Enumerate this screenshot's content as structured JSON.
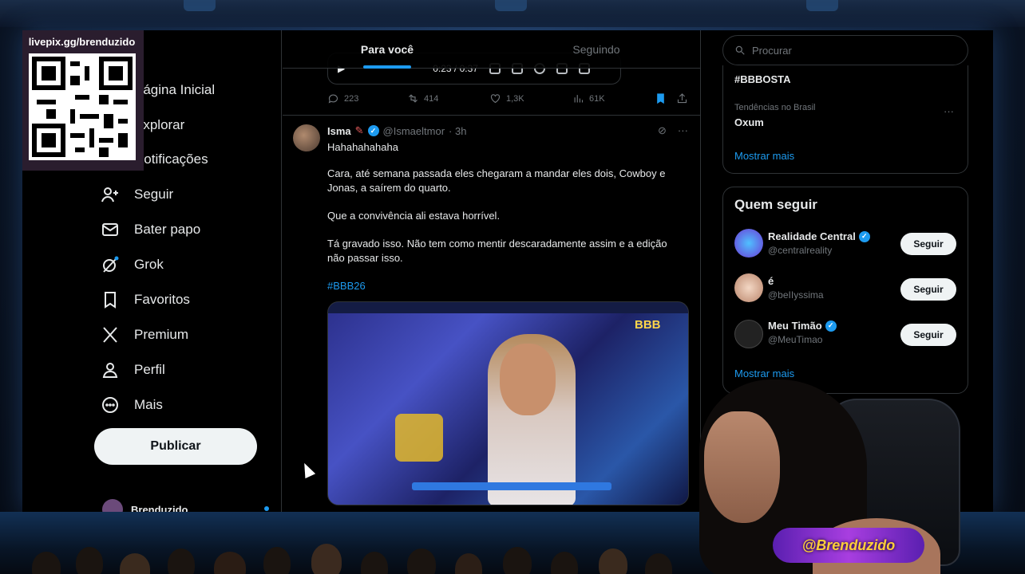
{
  "overlay": {
    "qr_label": "livepix.gg/brenduzido",
    "streamer_badge": "@Brenduzido"
  },
  "nav": {
    "items": [
      {
        "label": "Página Inicial",
        "icon": "home-icon"
      },
      {
        "label": "Explorar",
        "icon": "search-icon"
      },
      {
        "label": "Notificações",
        "icon": "bell-icon"
      },
      {
        "label": "Seguir",
        "icon": "add-user-icon"
      },
      {
        "label": "Bater papo",
        "icon": "mail-icon"
      },
      {
        "label": "Grok",
        "icon": "grok-icon"
      },
      {
        "label": "Favoritos",
        "icon": "bookmark-icon"
      },
      {
        "label": "Premium",
        "icon": "x-logo-icon"
      },
      {
        "label": "Perfil",
        "icon": "profile-icon"
      },
      {
        "label": "Mais",
        "icon": "more-circle-icon"
      }
    ],
    "publish_label": "Publicar",
    "account_name": "Brenduzido"
  },
  "feed": {
    "tabs": [
      {
        "label": "Para você",
        "active": true
      },
      {
        "label": "Seguindo",
        "active": false
      }
    ],
    "prev_tweet": {
      "audio_time": "0:23 / 0:37",
      "replies": "223",
      "reposts": "414",
      "likes": "1,3K",
      "views": "61K"
    },
    "tweet": {
      "name": "Isma",
      "handle": "@Ismaeltmor",
      "time": "· 3h",
      "lines": [
        "Hahahahahaha",
        "Cara, até semana passada eles chegaram a mandar eles dois, Cowboy e Jonas, a saírem do quarto.",
        "Que a convivência ali estava horrível.",
        "Tá gravado isso. Não tem como mentir descaradamente assim e a edição não passar isso."
      ],
      "hashtag": "#BBB26",
      "media_logo": "BBB"
    }
  },
  "right": {
    "search_placeholder": "Procurar",
    "trends": [
      {
        "context": "",
        "name": "#BBBOSTA"
      },
      {
        "context": "Tendências no Brasil",
        "name": "Oxum"
      }
    ],
    "trends_more": "Mostrar mais",
    "who_title": "Quem seguir",
    "who": [
      {
        "name": "Realidade Central",
        "handle": "@centralreality",
        "verified": true,
        "button": "Seguir"
      },
      {
        "name": "é",
        "handle": "@beIIyssima",
        "verified": false,
        "button": "Seguir"
      },
      {
        "name": "Meu Timão",
        "handle": "@MeuTimao",
        "verified": true,
        "button": "Seguir"
      }
    ],
    "who_more": "Mostrar mais"
  },
  "colors": {
    "accent": "#1d9bf0",
    "background": "#000000",
    "text_primary": "#e7e9ea",
    "text_secondary": "#71767b"
  }
}
